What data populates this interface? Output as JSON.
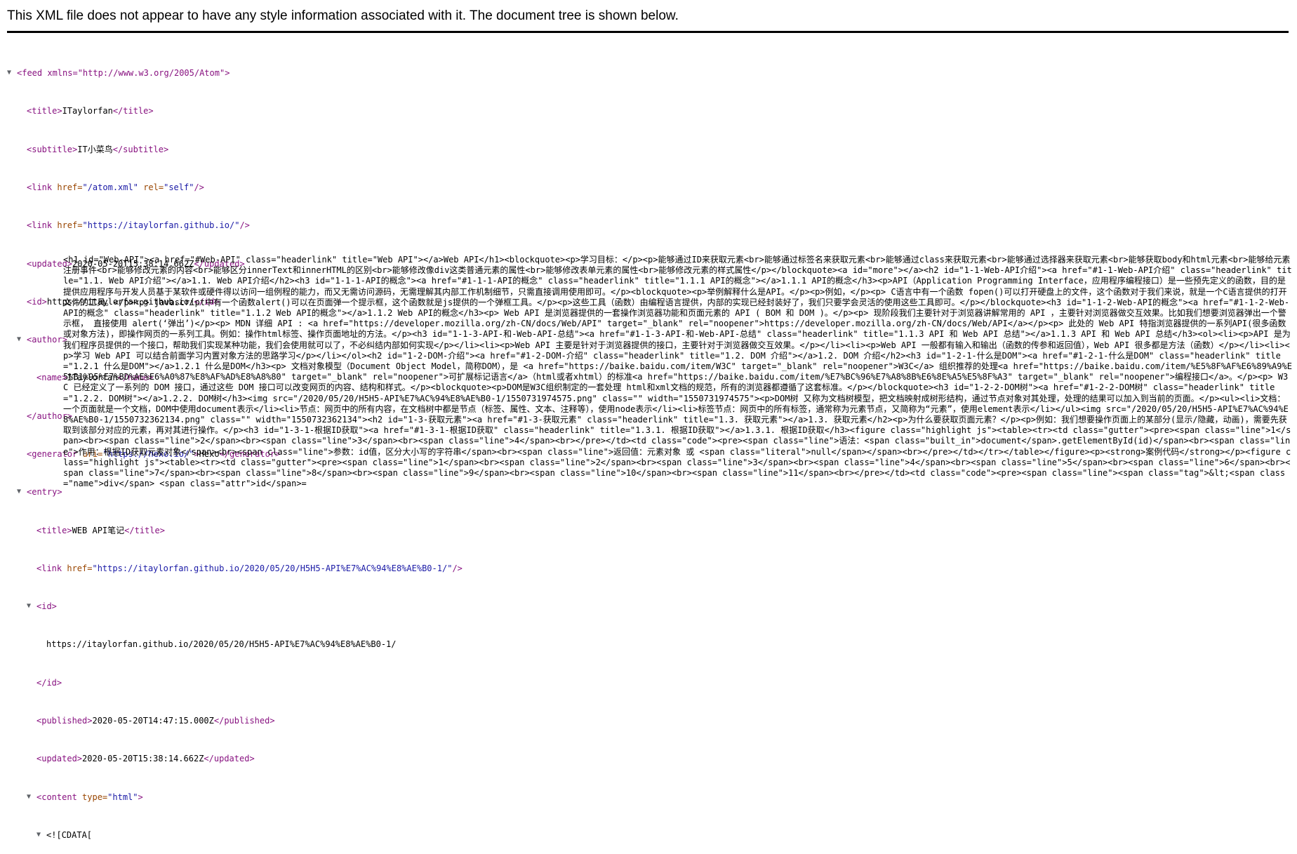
{
  "notice": "This XML file does not appear to have any style information associated with it. The document tree is shown below.",
  "tree": {
    "feed_open": "<feed xmlns=\"http://www.w3.org/2005/Atom\">",
    "title": {
      "open": "<title>",
      "text": "ITaylorfan",
      "close": "</title>"
    },
    "subtitle": {
      "open": "<subtitle>",
      "text": "IT小菜鸟",
      "close": "</subtitle>"
    },
    "link1": {
      "pre": "<link ",
      "attr1": "href=",
      "val1": "\"/atom.xml\"",
      "attr2": " rel=",
      "val2": "\"self\"",
      "post": "/>"
    },
    "link2": {
      "pre": "<link ",
      "attr1": "href=",
      "val1": "\"https://itaylorfan.github.io/\"",
      "post": "/>"
    },
    "updated": {
      "open": "<updated>",
      "text": "2020-05-20T15:38:14.662Z",
      "close": "</updated>"
    },
    "id": {
      "open": "<id>",
      "text": "https://itaylorfan.github.io/",
      "close": "</id>"
    },
    "author_open": "<author>",
    "author_name": {
      "open": "<name>",
      "text": "ITaylorfan",
      "close": "</name>"
    },
    "author_close": "</author>",
    "generator": {
      "pre": "<generator ",
      "attr": "uri=",
      "val": "\"https://hexo.io/\"",
      "mid": ">",
      "text": "Hexo",
      "close": "</generator>"
    },
    "entry_open": "<entry>",
    "entry_title": {
      "open": "<title>",
      "text": "WEB API笔记",
      "close": "</title>"
    },
    "entry_link": {
      "pre": "<link ",
      "attr": "href=",
      "val": "\"https://itaylorfan.github.io/2020/05/20/H5H5-API%E7%AC%94%E8%AE%B0-1/\"",
      "post": "/>"
    },
    "entry_id_open": "<id>",
    "entry_id_text": "https://itaylorfan.github.io/2020/05/20/H5H5-API%E7%AC%94%E8%AE%B0-1/",
    "entry_id_close": "</id>",
    "published": {
      "open": "<published>",
      "text": "2020-05-20T14:47:15.000Z",
      "close": "</published>"
    },
    "entry_updated": {
      "open": "<updated>",
      "text": "2020-05-20T15:38:14.662Z",
      "close": "</updated>"
    },
    "content": {
      "pre": "<content ",
      "attr": "type=",
      "val": "\"html\"",
      "post": ">"
    },
    "cdata_open": "<![CDATA[",
    "cdata_text": "<h1 id=\"Web-API\"><a href=\"#Web-API\" class=\"headerlink\" title=\"Web API\"></a>Web API</h1><blockquote><p>学习目标：</p><p>能够通过ID来获取元素<br>能够通过标签名来获取元素<br>能够通过class来获取元素<br>能够通过选择器来获取元素<br>能够获取body和html元素<br>能够给元素注册事件<br>能够修改元素的内容<br>能够区分innerText和innerHTML的区别<br>能够修改像div这类普通元素的属性<br>能够修改表单元素的属性<br>能够修改元素的样式属性</p></blockquote><a id=\"more\"></a><h2 id=\"1-1-Web-API介绍\"><a href=\"#1-1-Web-API介绍\" class=\"headerlink\" title=\"1.1. Web API介绍\"></a>1.1. Web API介绍</h2><h3 id=\"1-1-1-API的概念\"><a href=\"#1-1-1-API的概念\" class=\"headerlink\" title=\"1.1.1 API的概念\"></a>1.1.1 API的概念</h3><p>API（Application Programming Interface，应用程序编程接口）是一些预先定义的函数，目的是提供应用程序与开发人员基于某软件或硬件得以访问一组例程的能力，而又无需访问源码，无需理解其内部工作机制细节，只需直接调用使用即可。</p><blockquote><p>举例解释什么是API。</p><p>例如，</p><p> C语言中有一个函数 fopen()可以打开硬盘上的文件，这个函数对于我们来说，就是一个C语言提供的打开文件的工具。</p><p> javascript中有一个函数alert()可以在页面弹一个提示框，这个函数就是js提供的一个弹框工具。</p><p>这些工具（函数）由编程语言提供，内部的实现已经封装好了，我们只要学会灵活的使用这些工具即可。</p></blockquote><h3 id=\"1-1-2-Web-API的概念\"><a href=\"#1-1-2-Web-API的概念\" class=\"headerlink\" title=\"1.1.2 Web API的概念\"></a>1.1.2 Web API的概念</h3><p> Web API 是浏览器提供的一套操作浏览器功能和页面元素的 API ( BOM 和 DOM )。</p><p> 现阶段我们主要针对于浏览器讲解常用的 API ，主要针对浏览器做交互效果。比如我们想要浏览器弹出一个警示框， 直接使用 alert(‘弹出’)</p><p> MDN 详细 API : <a href=\"https://developer.mozilla.org/zh-CN/docs/Web/API\" target=\"_blank\" rel=\"noopener\">https://developer.mozilla.org/zh-CN/docs/Web/API</a></p><p> 此处的 Web API 特指浏览器提供的一系列API(很多函数或对象方法)，即操作网页的一系列工具。例如：操作html标签、操作页面地址的方法。</p><h3 id=\"1-1-3-API-和-Web-API-总结\"><a href=\"#1-1-3-API-和-Web-API-总结\" class=\"headerlink\" title=\"1.1.3 API 和 Web API 总结\"></a>1.1.3 API 和 Web API 总结</h3><ol><li><p>API 是为我们程序员提供的一个接口，帮助我们实现某种功能，我们会使用就可以了，不必纠结内部如何实现</p></li><li><p>Web API 主要是针对于浏览器提供的接口，主要针对于浏览器做交互效果。</p></li><li><p>Web API 一般都有输入和输出（函数的传参和返回值），Web API 很多都是方法（函数）</p></li><li><p>学习 Web API 可以结合前面学习内置对象方法的思路学习</p></li></ol><h2 id=\"1-2-DOM-介绍\"><a href=\"#1-2-DOM-介绍\" class=\"headerlink\" title=\"1.2. DOM 介绍\"></a>1.2. DOM 介绍</h2><h3 id=\"1-2-1-什么是DOM\"><a href=\"#1-2-1-什么是DOM\" class=\"headerlink\" title=\"1.2.1 什么是DOM\"></a>1.2.1 什么是DOM</h3><p> 文档对象模型（Document Object Model，简称DOM），是 <a href=\"https://baike.baidu.com/item/W3C\" target=\"_blank\" rel=\"noopener\">W3C</a> 组织推荐的处理<a href=\"https://baike.baidu.com/item/%E5%8F%AF%E6%89%A9%E5%B1%95%E7%BD%AE%E6%A0%87%E8%AF%AD%E8%A8%80\" target=\"_blank\" rel=\"noopener\">可扩展标记语言</a>（html或者xhtml）的标准<a href=\"https://baike.baidu.com/item/%E7%BC%96%E7%A8%8B%E6%8E%A5%E5%8F%A3\" target=\"_blank\" rel=\"noopener\">编程接口</a>。</p><p> W3C 已经定义了一系列的 DOM 接口，通过这些 DOM 接口可以改变网页的内容、结构和样式。</p><blockquote><p>DOM是W3C组织制定的一套处理 html和xml文档的规范，所有的浏览器都遵循了这套标准。</p></blockquote><h3 id=\"1-2-2-DOM树\"><a href=\"#1-2-2-DOM树\" class=\"headerlink\" title=\"1.2.2. DOM树\"></a>1.2.2. DOM树</h3><img src=\"/2020/05/20/H5H5-API%E7%AC%94%E8%AE%B0-1/1550731974575.png\" class=\"\" width=\"1550731974575\"><p>DOM树 又称为文档树模型，把文档映射成树形结构，通过节点对象对其处理，处理的结果可以加入到当前的页面。</p><ul><li>文档：一个页面就是一个文档，DOM中使用document表示</li><li>节点：网页中的所有内容，在文档树中都是节点（标签、属性、文本、注释等），使用node表示</li><li>标签节点：网页中的所有标签，通常称为元素节点，又简称为“元素”，使用element表示</li></ul><img src=\"/2020/05/20/H5H5-API%E7%AC%94%E8%AE%B0-1/1550732362134.png\" class=\"\" width=\"1550732362134\"><h2 id=\"1-3-获取元素\"><a href=\"#1-3-获取元素\" class=\"headerlink\" title=\"1.3. 获取元素\"></a>1.3. 获取元素</h2><p>为什么要获取页面元素？</p><p>例如：我们想要操作页面上的某部分(显示/隐藏，动画)，需要先获取到该部分对应的元素，再对其进行操作。</p><h3 id=\"1-3-1-根据ID获取\"><a href=\"#1-3-1-根据ID获取\" class=\"headerlink\" title=\"1.3.1. 根据ID获取\"></a>1.3.1. 根据ID获取</h3><figure class=\"highlight js\"><table><tr><td class=\"gutter\"><pre><span class=\"line\">1</span><br><span class=\"line\">2</span><br><span class=\"line\">3</span><br><span class=\"line\">4</span><br></pre></td><td class=\"code\"><pre><span class=\"line\">语法：<span class=\"built_in\">document</span>.getElementById(id)</span><br><span class=\"line\">作用：根据ID获取元素对象</span><br><span class=\"line\">参数：id值，区分大小写的字符串</span><br><span class=\"line\">返回值：元素对象 或 <span class=\"literal\">null</span></span><br></pre></td></tr></table></figure><p><strong>案例代码</strong></p><figure class=\"highlight js\"><table><tr><td class=\"gutter\"><pre><span class=\"line\">1</span><br><span class=\"line\">2</span><br><span class=\"line\">3</span><br><span class=\"line\">4</span><br><span class=\"line\">5</span><br><span class=\"line\">6</span><br><span class=\"line\">7</span><br><span class=\"line\">8</span><br><span class=\"line\">9</span><br><span class=\"line\">10</span><br><span class=\"line\">11</span><br></pre></td><td class=\"code\"><pre><span class=\"line\"><span class=\"tag\">&lt;<span class=\"name\">div</span> <span class=\"attr\">id</span>="
  }
}
